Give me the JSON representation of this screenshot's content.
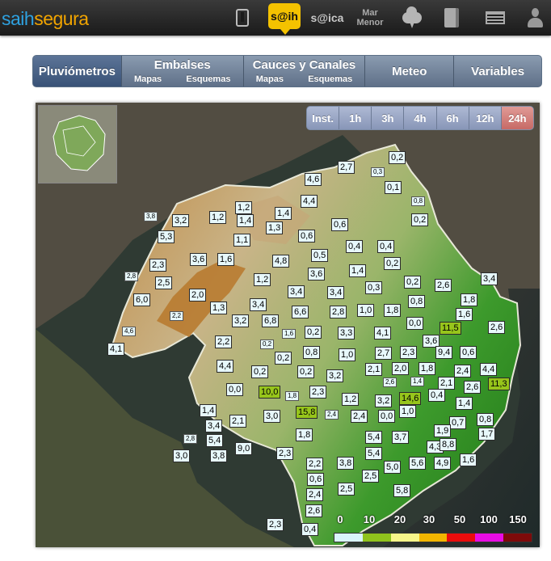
{
  "brand": {
    "part1": "saih",
    "part2": "segura"
  },
  "top_icons": [
    {
      "name": "tablet-icon"
    },
    {
      "name": "saih-icon",
      "label": "s@ih"
    },
    {
      "name": "sica-icon",
      "label": "s@ica"
    },
    {
      "name": "mar-menor-icon",
      "label1": "Mar",
      "label2": "Menor"
    },
    {
      "name": "weather-cloud-icon"
    },
    {
      "name": "book-icon"
    },
    {
      "name": "screen-icon"
    },
    {
      "name": "user-icon"
    }
  ],
  "nav": {
    "pluviometros": "Pluviómetros",
    "embalses": {
      "label": "Embalses",
      "sub1": "Mapas",
      "sub2": "Esquemas"
    },
    "cauces": {
      "label": "Cauces y Canales",
      "sub1": "Mapas",
      "sub2": "Esquemas"
    },
    "meteo": "Meteo",
    "variables": "Variables"
  },
  "time_buttons": [
    "Inst.",
    "1h",
    "3h",
    "4h",
    "6h",
    "12h",
    "24h"
  ],
  "active_time": "24h",
  "legend": {
    "ticks": [
      "0",
      "10",
      "20",
      "30",
      "50",
      "100",
      "150"
    ],
    "colors": [
      "#d9f5fb",
      "#8fc31c",
      "#f8f68a",
      "#f2b500",
      "#ea0c0c",
      "#e80ce4",
      "#7e0a0a"
    ]
  },
  "readings": [
    "0,2",
    "2,7",
    "0,3",
    "4,6",
    "0,1",
    "1,2",
    "4,4",
    "0,8",
    "3,8",
    "3,2",
    "1,2",
    "1,4",
    "1,4",
    "0,2",
    "5,3",
    "1,3",
    "0,6",
    "1,1",
    "0,6",
    "0,4",
    "0,4",
    "2,3",
    "3,6",
    "1,6",
    "4,8",
    "0,5",
    "0,2",
    "2,8",
    "2,5",
    "1,2",
    "1,4",
    "3,6",
    "3,4",
    "0,2",
    "2,6",
    "3,4",
    "6,0",
    "2,0",
    "3,4",
    "3,4",
    "0,3",
    "1,8",
    "1,3",
    "2,2",
    "6,6",
    "2,8",
    "1,0",
    "1,8",
    "0,8",
    "1,6",
    "4,6",
    "3,2",
    "6,8",
    "0,0",
    "11,5",
    "2,6",
    "1,6",
    "0,2",
    "3,3",
    "4,1",
    "4,1",
    "2,2",
    "0,2",
    "0,8",
    "3,6",
    "1,0",
    "2,7",
    "2,3",
    "9,4",
    "0,6",
    "0,2",
    "4,4",
    "0,2",
    "0,2",
    "2,1",
    "2,0",
    "1,8",
    "2,4",
    "4,4",
    "3,2",
    "2,6",
    "1,4",
    "2,1",
    "2,6",
    "11,3",
    "0,0",
    "10,0",
    "1,8",
    "2,3",
    "1,2",
    "3,2",
    "14,6",
    "0,4",
    "1,4",
    "1,4",
    "3,0",
    "15,8",
    "2,4",
    "2,4",
    "0,0",
    "1,0",
    "0,7",
    "0,8",
    "3,4",
    "2,1",
    "1,9",
    "1,7",
    "2,8",
    "5,4",
    "1,8",
    "5,4",
    "3,7",
    "4,3",
    "8,8",
    "9,0",
    "2,3",
    "3,0",
    "3,8",
    "5,4",
    "5,6",
    "4,9",
    "1,6",
    "5,0",
    "2,2",
    "3,8",
    "2,5",
    "0,6",
    "2,5",
    "5,8",
    "2,4",
    "2,6",
    "2,3",
    "0,4"
  ]
}
